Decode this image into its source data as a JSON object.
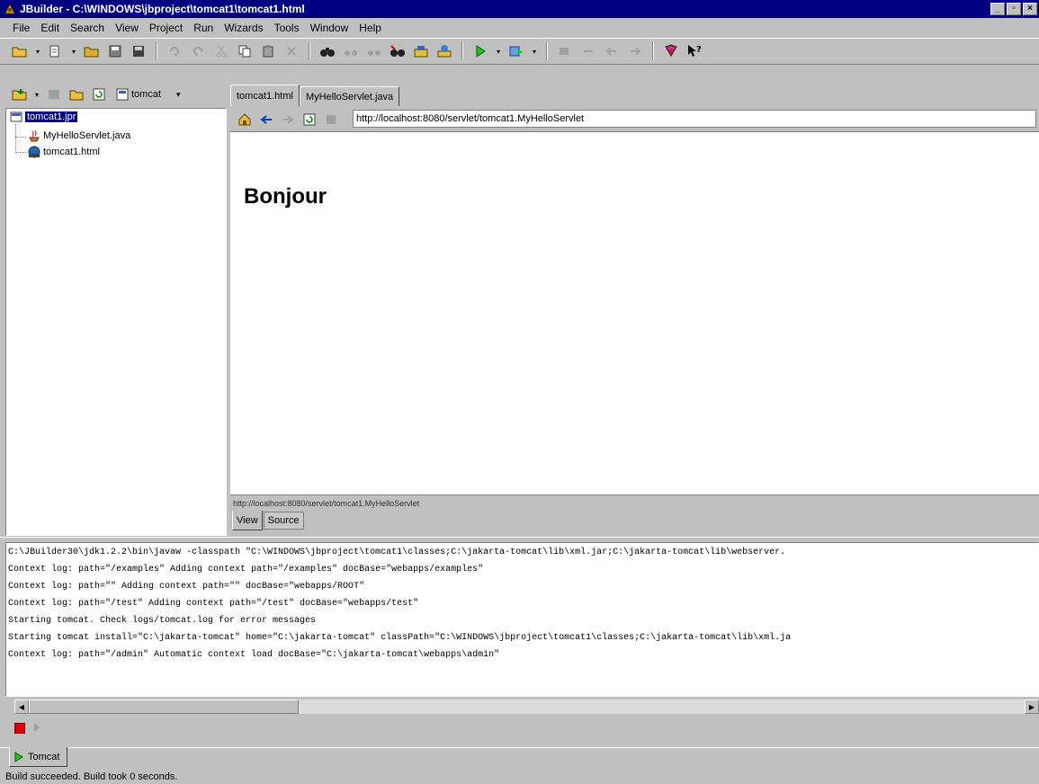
{
  "window": {
    "title": "JBuilder - C:\\WINDOWS\\jbproject\\tomcat1\\tomcat1.html",
    "minimize_glyph": "_",
    "maximize_glyph": "▫",
    "close_glyph": "×"
  },
  "menubar": {
    "items": [
      "File",
      "Edit",
      "Search",
      "View",
      "Project",
      "Run",
      "Wizards",
      "Tools",
      "Window",
      "Help"
    ]
  },
  "project_toolbar": {
    "combo_label": "tomcat"
  },
  "editor_tabs": [
    {
      "label": "tomcat1.html",
      "active": true
    },
    {
      "label": "MyHelloServlet.java",
      "active": false
    }
  ],
  "project_tree": {
    "root": {
      "label": "tomcat1.jpr",
      "selected": true
    },
    "children": [
      {
        "label": "MyHelloServlet.java",
        "icon": "java-file-icon"
      },
      {
        "label": "tomcat1.html",
        "icon": "html-file-icon"
      }
    ]
  },
  "browser": {
    "url": "http://localhost:8080/servlet/tomcat1.MyHelloServlet",
    "page_heading": "Bonjour",
    "status_text": "http://localhost:8080/servlet/tomcat1.MyHelloServlet",
    "view_tabs": [
      {
        "label": "View",
        "active": true
      },
      {
        "label": "Source",
        "active": false
      }
    ]
  },
  "console": {
    "lines": [
      "C:\\JBuilder30\\jdk1.2.2\\bin\\javaw  -classpath \"C:\\WINDOWS\\jbproject\\tomcat1\\classes;C:\\jakarta-tomcat\\lib\\xml.jar;C:\\jakarta-tomcat\\lib\\webserver.",
      "Context log: path=\"/examples\" Adding context path=\"/examples\"  docBase=\"webapps/examples\"",
      "Context log: path=\"\" Adding context path=\"\"  docBase=\"webapps/ROOT\"",
      "Context log: path=\"/test\" Adding context path=\"/test\"  docBase=\"webapps/test\"",
      "Starting tomcat. Check logs/tomcat.log for error messages",
      "Starting tomcat install=\"C:\\jakarta-tomcat\" home=\"C:\\jakarta-tomcat\" classPath=\"C:\\WINDOWS\\jbproject\\tomcat1\\classes;C:\\jakarta-tomcat\\lib\\xml.ja",
      "Context log: path=\"/admin\" Automatic context load docBase=\"C:\\jakarta-tomcat\\webapps\\admin\""
    ]
  },
  "run_tab": {
    "label": "Tomcat"
  },
  "statusbar": {
    "text": "Build succeeded. Build took 0 seconds."
  }
}
